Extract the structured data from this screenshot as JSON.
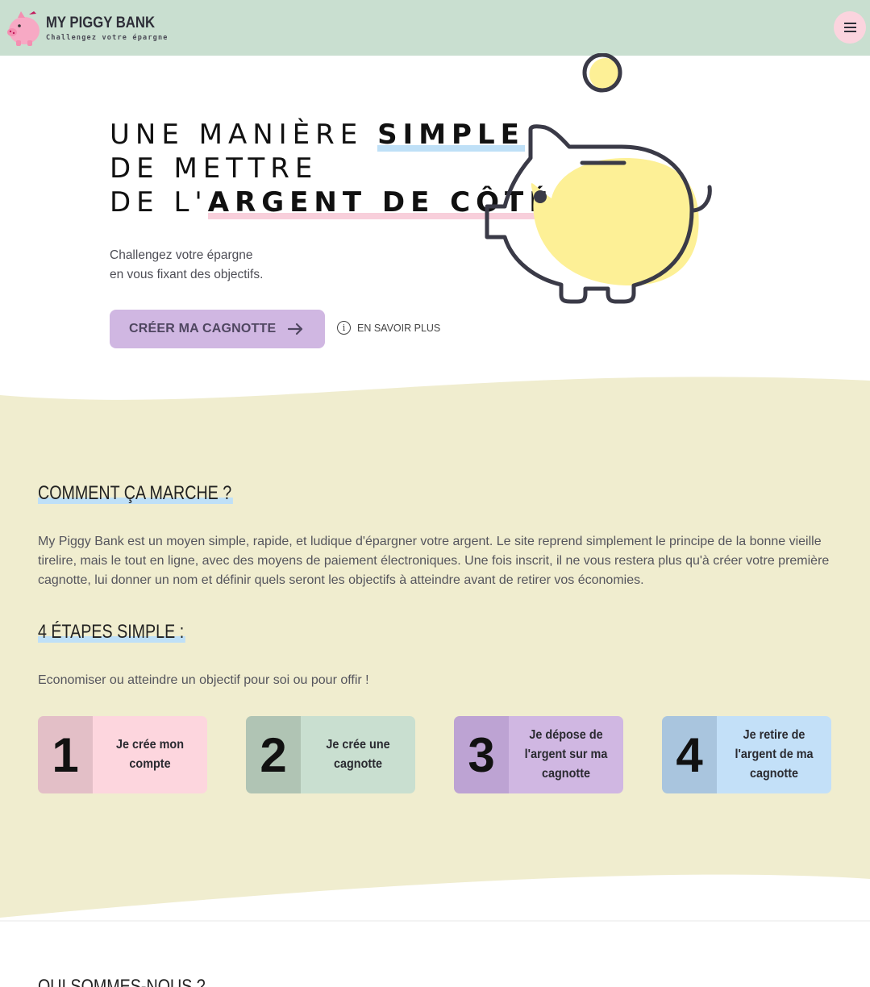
{
  "header": {
    "brand_name": "MY PIGGY BANK",
    "brand_tagline": "Challengez votre épargne",
    "menu_icon": "hamburger-icon",
    "bg_color": "#c9dfd0"
  },
  "hero": {
    "title_line1_plain": "UNE MANIÈRE ",
    "title_line1_bold": "SIMPLE",
    "title_line2": "DE METTRE",
    "title_line3_plain": "DE L'",
    "title_line3_bold": "ARGENT DE CÔTÉ",
    "subtitle_line1": "Challengez votre épargne",
    "subtitle_line2": "en vous fixant des objectifs.",
    "cta_label": "CRÉER MA CAGNOTTE",
    "cta_icon": "arrow-right-icon",
    "learn_more_label": "EN SAVOIR PLUS",
    "learn_more_icon": "info-icon",
    "illustration": "piggy-bank-icon"
  },
  "how_it_works": {
    "title": "COMMENT ÇA MARCHE ?",
    "description": "My Piggy Bank est un moyen simple, rapide, et ludique d'épargner votre argent. Le site reprend simplement le principe de la bonne vieille tirelire, mais le tout en ligne, avec des moyens de paiement électroniques. Une fois inscrit, il ne vous restera plus qu'à créer votre première cagnotte, lui donner un nom et définir quels seront les objectifs à atteindre avant de retirer vos économies.",
    "steps_title": "4 ÉTAPES SIMPLE :",
    "steps_subtitle": "Economiser ou atteindre un objectif pour soi ou pour offir !",
    "steps": [
      {
        "number": "1",
        "label": "Je crée mon compte",
        "num_color": "#e3bfc7",
        "bg_color": "#fdd6de"
      },
      {
        "number": "2",
        "label": "Je crée une cagnotte",
        "num_color": "#b0c4b4",
        "bg_color": "#c9dfd0"
      },
      {
        "number": "3",
        "label": "Je dépose de l'argent sur ma cagnotte",
        "num_color": "#bda3d3",
        "bg_color": "#d0b7e2"
      },
      {
        "number": "4",
        "label": "Je retire de l'argent de ma cagnotte",
        "num_color": "#a9c5de",
        "bg_color": "#c3e0f8"
      }
    ],
    "bg_color": "#f0edcf"
  },
  "about": {
    "title": "QUI SOMMES-NOUS ?"
  }
}
